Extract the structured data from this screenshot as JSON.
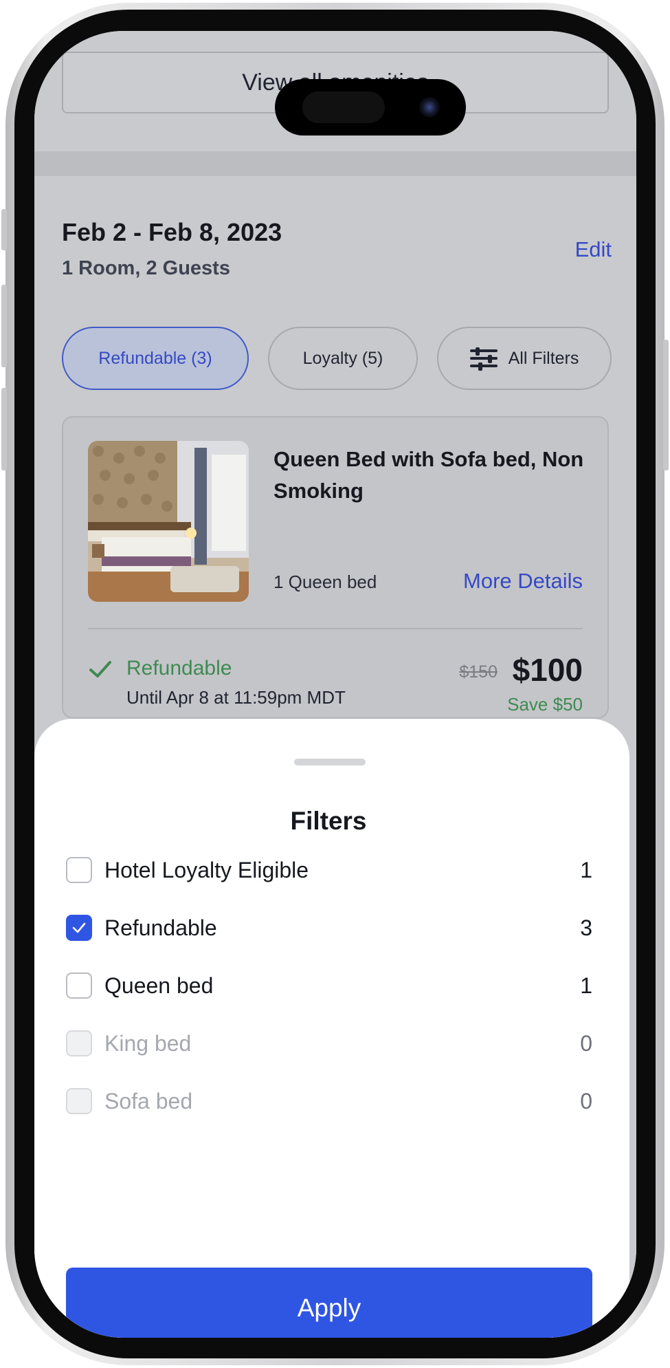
{
  "background": {
    "amenities_button": "View all amenities",
    "stay": {
      "dates": "Feb 2 - Feb 8, 2023",
      "guests": "1 Room, 2 Guests",
      "edit": "Edit"
    },
    "chips": [
      {
        "label": "Refundable (3)",
        "active": true
      },
      {
        "label": "Loyalty (5)",
        "active": false
      },
      {
        "label": "All Filters",
        "icon": "sliders-icon",
        "active": false
      }
    ],
    "room": {
      "title": "Queen Bed with Sofa bed, Non Smoking",
      "beds": "1 Queen bed",
      "more_details": "More Details",
      "refund_label": "Refundable",
      "refund_until": "Until Apr 8 at 11:59pm MDT",
      "old_price": "$150",
      "new_price": "$100",
      "savings": "Save $50",
      "check_icon": "check-icon"
    }
  },
  "sheet": {
    "title": "Filters",
    "filters": [
      {
        "label": "Hotel Loyalty Eligible",
        "count": "1",
        "checked": false,
        "disabled": false
      },
      {
        "label": "Refundable",
        "count": "3",
        "checked": true,
        "disabled": false
      },
      {
        "label": "Queen bed",
        "count": "1",
        "checked": false,
        "disabled": false
      },
      {
        "label": "King bed",
        "count": "0",
        "checked": false,
        "disabled": true
      },
      {
        "label": "Sofa bed",
        "count": "0",
        "checked": false,
        "disabled": true
      }
    ],
    "apply": "Apply"
  },
  "colors": {
    "accent": "#2f55e3",
    "link": "#3549c4",
    "success": "#3f8a52"
  }
}
